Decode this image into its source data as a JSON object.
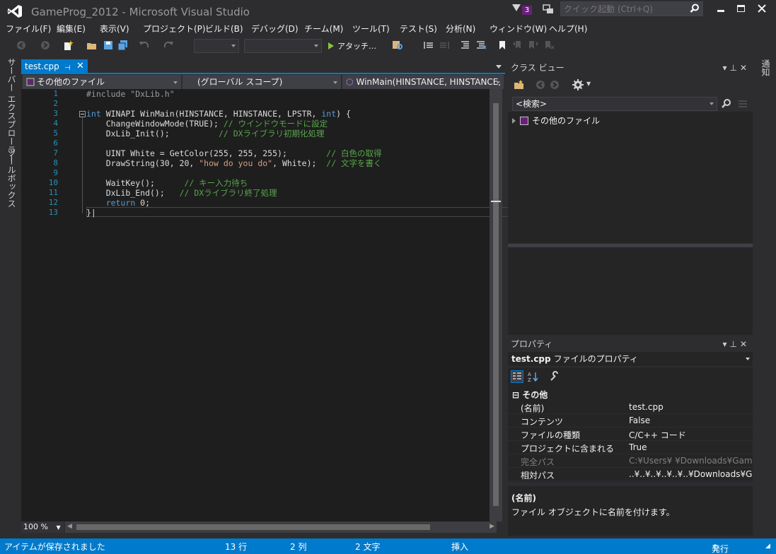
{
  "window": {
    "title": "GameProg_2012 - Microsoft Visual Studio",
    "notification_count": "3",
    "quick_launch_placeholder": "クイック起動 (Ctrl+Q)"
  },
  "menu": [
    "ファイル(F)",
    "編集(E)",
    "表示(V)",
    "プロジェクト(P)",
    "ビルド(B)",
    "デバッグ(D)",
    "チーム(M)",
    "ツール(T)",
    "テスト(S)",
    "分析(N)",
    "ウィンドウ(W)",
    "ヘルプ(H)"
  ],
  "toolbar": {
    "attach_label": "アタッチ…"
  },
  "left_tabs": [
    "サーバー エクスプローラー",
    "ツールボックス"
  ],
  "right_tabs": [
    "通知"
  ],
  "editor": {
    "tab_name": "test.cpp",
    "nav_file": "その他のファイル",
    "nav_scope": "(グローバル スコープ)",
    "nav_member": "WinMain(HINSTANCE, HINSTANCE, LPSTR, int)",
    "zoom": "100 %",
    "line_numbers": [
      "1",
      "2",
      "3",
      "4",
      "5",
      "6",
      "7",
      "8",
      "9",
      "10",
      "11",
      "12",
      "13"
    ]
  },
  "class_view": {
    "title": "クラス ビュー",
    "search_placeholder": "<検索>",
    "tree_item": "その他のファイル"
  },
  "properties": {
    "title": "プロパティ",
    "object_name": "test.cpp",
    "object_type": "ファイルのプロパティ",
    "category": "その他",
    "rows": [
      {
        "key": "(名前)",
        "value": "test.cpp"
      },
      {
        "key": "コンテンツ",
        "value": "False"
      },
      {
        "key": "ファイルの種類",
        "value": "C/C++ コード"
      },
      {
        "key": "プロジェクトに含まれる",
        "value": "True"
      },
      {
        "key": "完全パス",
        "value": "C:¥Users¥        ¥Downloads¥GameProg"
      },
      {
        "key": "相対パス",
        "value": "..¥..¥..¥..¥..¥..¥Downloads¥GameProg"
      }
    ],
    "desc_name": "(名前)",
    "desc_text": "ファイル オブジェクトに名前を付けます。"
  },
  "status": {
    "message": "アイテムが保存されました",
    "line": "13 行",
    "col": "2 列",
    "char": "2 文字",
    "mode": "挿入",
    "publish": "発行"
  },
  "colors": {
    "accent": "#007acc",
    "editor_bg": "#1e1e1e",
    "keyword": "#569cd6",
    "comment": "#57a64a",
    "string": "#d69d85",
    "line_number": "#2b91af"
  }
}
